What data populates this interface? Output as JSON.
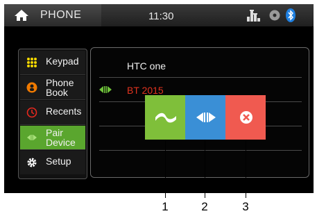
{
  "header": {
    "title": "PHONE",
    "clock": "11:30",
    "icons": [
      "home-icon",
      "equalizer-icon",
      "disc-icon",
      "bluetooth-icon"
    ]
  },
  "sidebar": {
    "items": [
      {
        "label": "Keypad",
        "icon": "keypad-icon",
        "color": "#f5d800"
      },
      {
        "label1": "Phone",
        "label2": "Book",
        "icon": "phonebook-icon",
        "color": "#f07a00"
      },
      {
        "label": "Recents",
        "icon": "recents-icon",
        "color": "#e8281e"
      },
      {
        "label1": "Pair",
        "label2": "Device",
        "icon": "pair-device-icon",
        "color": "#5aa62e",
        "active": true
      },
      {
        "label": "Setup",
        "icon": "gear-icon",
        "color": "#ffffff"
      }
    ]
  },
  "devices": [
    {
      "name": "HTC one",
      "connected": false
    },
    {
      "name": "BT 2015",
      "connected": true
    }
  ],
  "popup": {
    "buttons": [
      {
        "icon": "connect-icon",
        "color": "#7fbf3a"
      },
      {
        "icon": "disconnect-icon",
        "color": "#3a8fd6"
      },
      {
        "icon": "delete-icon",
        "color": "#f05a50"
      }
    ]
  },
  "callouts": [
    "1",
    "2",
    "3"
  ]
}
